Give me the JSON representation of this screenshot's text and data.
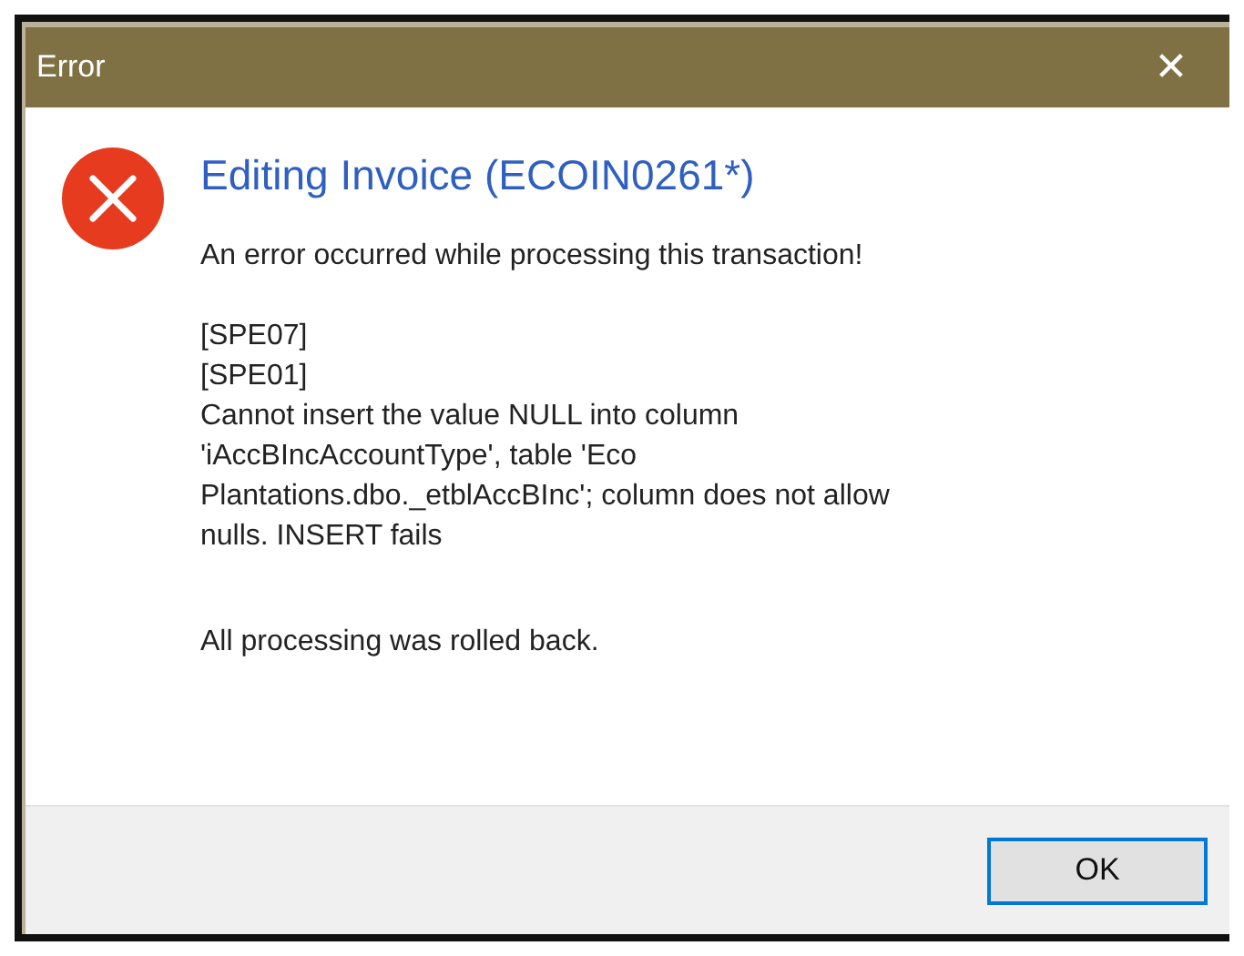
{
  "window": {
    "title": "Error",
    "close": "✕"
  },
  "heading": "Editing Invoice (ECOIN0261*)",
  "message": {
    "intro": "An error occurred while processing this transaction!",
    "detail": "[SPE07]\n[SPE01]\nCannot insert the value NULL into column\n'iAccBIncAccountType', table 'Eco\nPlantations.dbo._etblAccBInc'; column does not allow\nnulls. INSERT fails",
    "outro": "All processing was rolled back."
  },
  "buttons": [
    {
      "label": "OK",
      "default": true
    }
  ]
}
